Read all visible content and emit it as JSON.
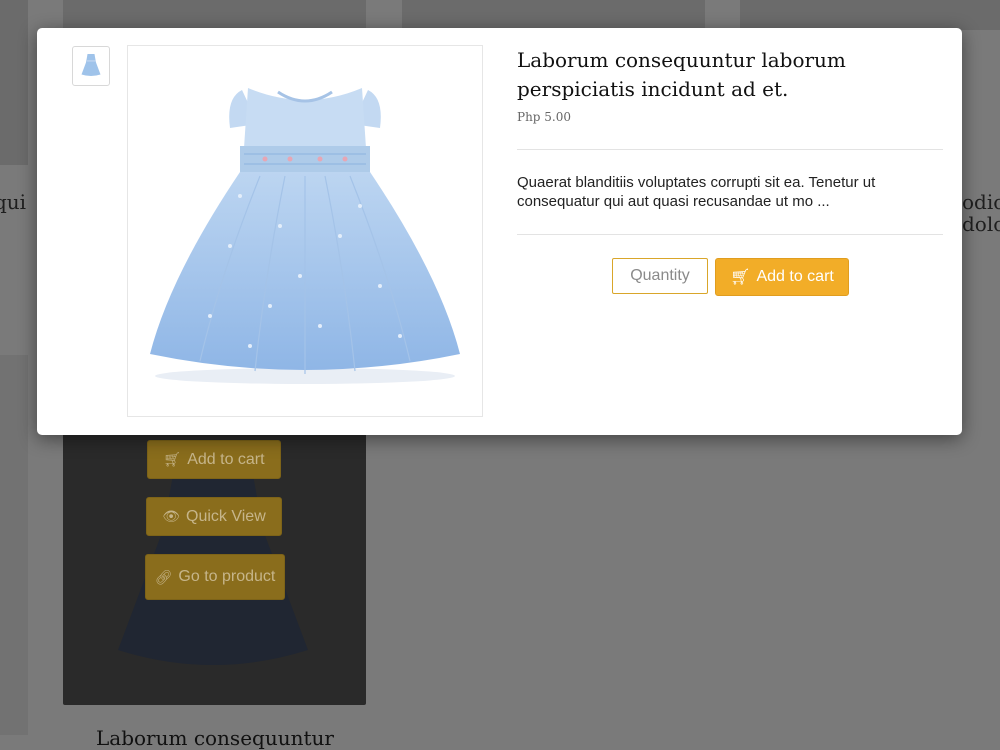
{
  "background": {
    "fragment_left": "qui",
    "fragment_right_1": "odio",
    "fragment_right_2": "dolo",
    "card_buttons": {
      "add_to_cart": "Add to cart",
      "quick_view": "Quick View",
      "go_to_product": "Go to product"
    },
    "product_title_partial": "Laborum consequuntur"
  },
  "modal": {
    "title": "Laborum consequuntur laborum perspiciatis incidunt ad et.",
    "price": "Php 5.00",
    "description": "Quaerat blanditiis voluptates corrupti sit ea. Tenetur ut consequatur qui aut quasi recusandae ut mo ...",
    "quantity_placeholder": "Quantity",
    "add_to_cart_label": "Add to cart",
    "accent_color": "#f2ad28",
    "image_icon": "dress-image"
  }
}
